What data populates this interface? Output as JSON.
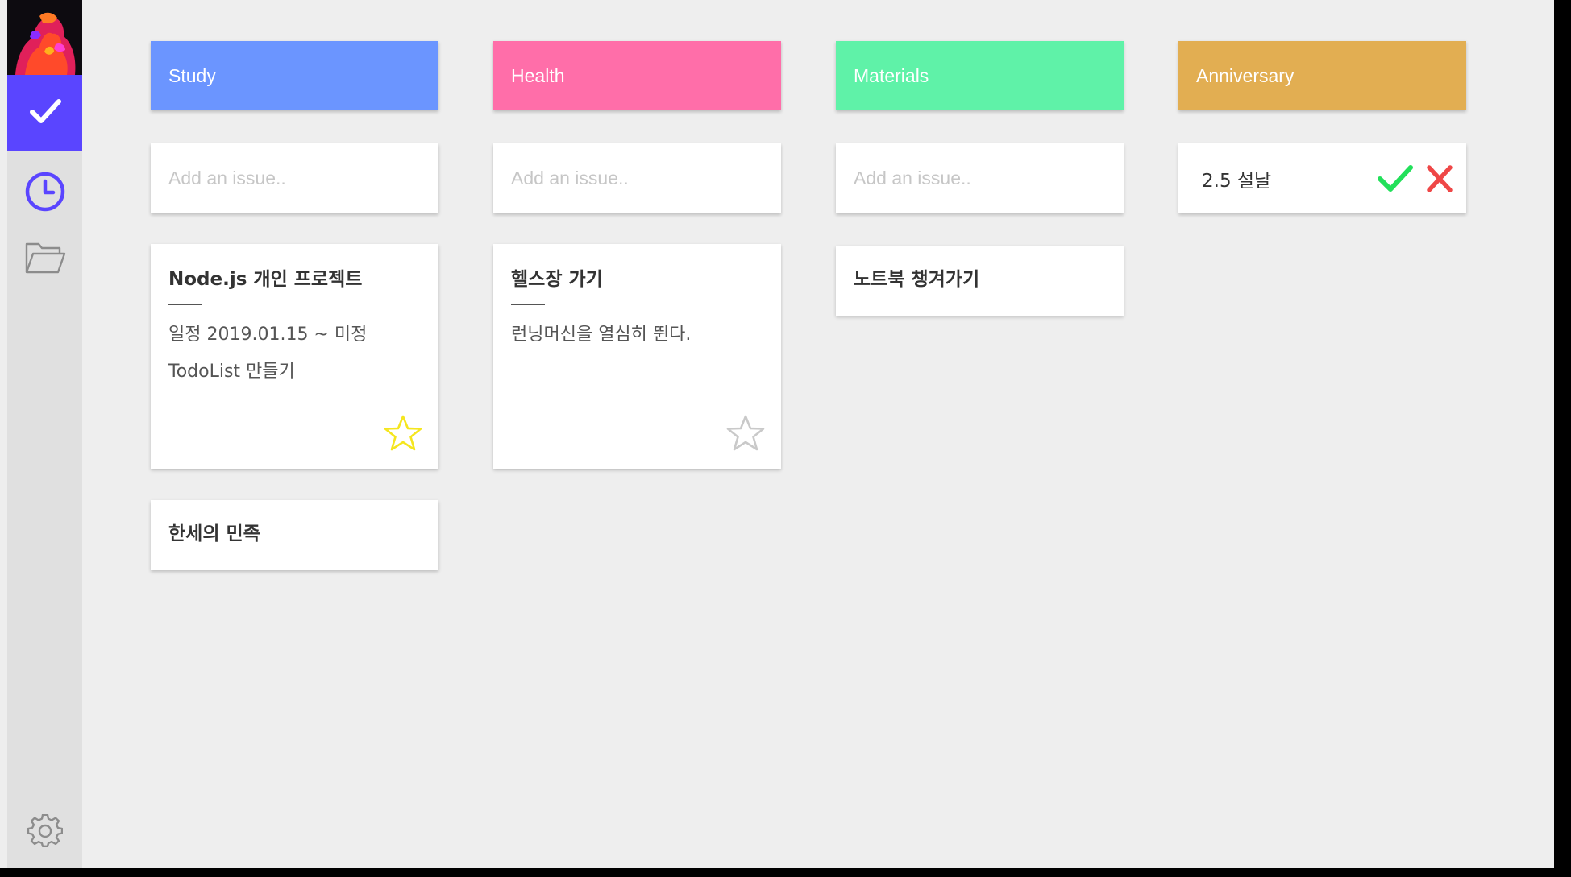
{
  "sidebar": {
    "items": [
      {
        "name": "check-icon"
      },
      {
        "name": "clock-icon"
      },
      {
        "name": "folder-icon"
      },
      {
        "name": "gear-icon"
      }
    ],
    "active_color": "#5a45ff"
  },
  "columns": [
    {
      "title": "Study",
      "color": "#6b95ff",
      "add_placeholder": "Add an issue..",
      "cards": [
        {
          "title": "Node.js 개인 프로젝트",
          "lines": [
            "일정 2019.01.15 ~ 미정",
            "TodoList 만들기"
          ],
          "starred": true
        },
        {
          "title": "한세의 민족"
        }
      ]
    },
    {
      "title": "Health",
      "color": "#ff6ea9",
      "add_placeholder": "Add an issue..",
      "cards": [
        {
          "title": "헬스장 가기",
          "lines": [
            "런닝머신을 열심히 뛴다."
          ],
          "starred": false
        }
      ]
    },
    {
      "title": "Materials",
      "color": "#5ff2a8",
      "add_placeholder": "Add an issue..",
      "cards": [
        {
          "title": "노트북 챙겨가기"
        }
      ]
    },
    {
      "title": "Anniversary",
      "color": "#e2ae52",
      "add_value": "2.5 설날",
      "confirm_color": "#22e05a",
      "cancel_color": "#ef4747"
    }
  ]
}
